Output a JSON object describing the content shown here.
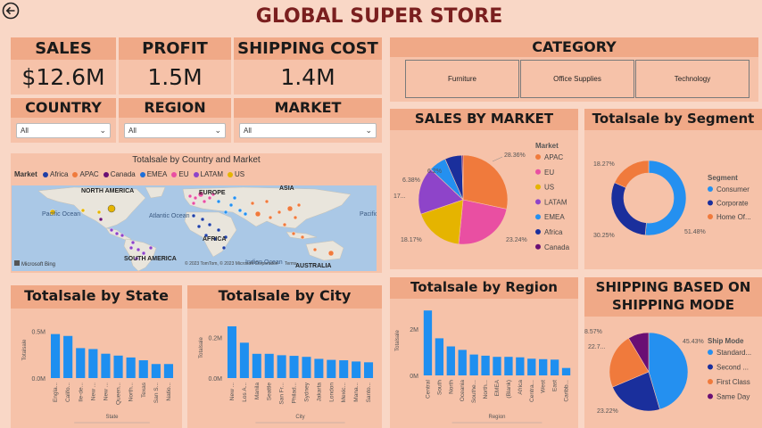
{
  "page_title": "GLOBAL SUPER STORE",
  "kpis": [
    {
      "label": "SALES",
      "value": "$12.6M"
    },
    {
      "label": "PROFIT",
      "value": "1.5M"
    },
    {
      "label": "SHIPPING COST",
      "value": "1.4M"
    }
  ],
  "filters": [
    {
      "label": "COUNTRY",
      "selected": "All"
    },
    {
      "label": "REGION",
      "selected": "All"
    },
    {
      "label": "MARKET",
      "selected": "All"
    }
  ],
  "category": {
    "title": "CATEGORY",
    "buttons": [
      "Furniture",
      "Office Supplies",
      "Technology"
    ]
  },
  "map": {
    "title": "Totalsale by Country and Market",
    "legend_title": "Market",
    "legend": [
      {
        "name": "Africa",
        "color": "#1f3fa6"
      },
      {
        "name": "APAC",
        "color": "#f07a3c"
      },
      {
        "name": "Canada",
        "color": "#6a0f74"
      },
      {
        "name": "EMEA",
        "color": "#1e6fd9"
      },
      {
        "name": "EU",
        "color": "#e94fa2"
      },
      {
        "name": "LATAM",
        "color": "#8e44c9"
      },
      {
        "name": "US",
        "color": "#e5b400"
      }
    ],
    "labels": [
      "NORTH AMERICA",
      "EUROPE",
      "ASIA",
      "Pacific Ocean",
      "Atlantic Ocean",
      "AFRICA",
      "Pacific Ocean",
      "SOUTH AMERICA",
      "Indian Ocean",
      "AUSTRALIA"
    ],
    "attribution": "© 2023 TomTom, © 2023 Microsoft Corporation",
    "attribution_terms": "Terms",
    "brand": "Microsoft Bing"
  },
  "sales_by_market": {
    "title": "SALES BY MARKET",
    "legend_title": "Market",
    "slice_labels": [
      "28.36%",
      "23.24%",
      "18.17%",
      "17...",
      "6.38%",
      "6.2%"
    ]
  },
  "segment": {
    "title": "Totalsale by Segment",
    "legend_title": "Segment",
    "legend": [
      {
        "name": "Consumer",
        "color": "#2490f0"
      },
      {
        "name": "Corporate",
        "color": "#1a2f9c"
      },
      {
        "name": "Home Of...",
        "color": "#f07a3c"
      }
    ],
    "slice_labels": [
      "51.48%",
      "30.25%",
      "18.27%"
    ]
  },
  "state_chart": {
    "title": "Totalsale by State",
    "ylabel": "Totalsale",
    "xlabel": "State",
    "ticks": [
      "0.5M",
      "0.0M"
    ]
  },
  "city_chart": {
    "title": "Totalsale by City",
    "ylabel": "Totalsale",
    "xlabel": "City",
    "ticks": [
      "0.2M",
      "0.0M"
    ]
  },
  "region_chart": {
    "title": "Totalsale by Region",
    "ylabel": "Totalsale",
    "xlabel": "Region",
    "ticks": [
      "2M",
      "0M"
    ]
  },
  "ship_mode": {
    "title_line1": "SHIPPING BASED ON",
    "title_line2": "SHIPPING MODE",
    "legend_title": "Ship Mode",
    "legend": [
      {
        "name": "Standard...",
        "color": "#2490f0"
      },
      {
        "name": "Second ...",
        "color": "#1a2f9c"
      },
      {
        "name": "First Class",
        "color": "#f07a3c"
      },
      {
        "name": "Same Day",
        "color": "#6a0f74"
      }
    ],
    "slice_labels": [
      "45.43%",
      "23.22%",
      "22.7...",
      "8.57%"
    ]
  },
  "chart_data": [
    {
      "type": "pie",
      "title": "SALES BY MARKET",
      "categories": [
        "APAC",
        "EU",
        "US",
        "LATAM",
        "EMEA",
        "Africa",
        "Canada"
      ],
      "values": [
        28.36,
        23.24,
        18.17,
        17.23,
        6.38,
        6.2,
        0.42
      ],
      "colors": [
        "#f07a3c",
        "#e94fa2",
        "#e5b400",
        "#8e44c9",
        "#2490f0",
        "#1a2f9c",
        "#6a0f74"
      ]
    },
    {
      "type": "pie",
      "title": "Totalsale by Segment",
      "categories": [
        "Consumer",
        "Corporate",
        "Home Of..."
      ],
      "values": [
        51.48,
        30.25,
        18.27
      ],
      "colors": [
        "#2490f0",
        "#1a2f9c",
        "#f07a3c"
      ]
    },
    {
      "type": "pie",
      "title": "SHIPPING BASED ON SHIPPING MODE",
      "categories": [
        "Standard...",
        "Second ...",
        "First Class",
        "Same Day"
      ],
      "values": [
        45.43,
        23.22,
        22.78,
        8.57
      ],
      "colors": [
        "#2490f0",
        "#1a2f9c",
        "#f07a3c",
        "#6a0f74"
      ]
    },
    {
      "type": "bar",
      "title": "Totalsale by State",
      "categories": [
        "Engla...",
        "Califo...",
        "Ile-de...",
        "New ...",
        "New ...",
        "Queen...",
        "North...",
        "Texas",
        "San S...",
        "Natio..."
      ],
      "values": [
        0.47,
        0.45,
        0.32,
        0.31,
        0.26,
        0.24,
        0.22,
        0.19,
        0.15,
        0.15
      ],
      "ylabel": "Totalsale",
      "xlabel": "State",
      "ylim": [
        0,
        0.6
      ]
    },
    {
      "type": "bar",
      "title": "Totalsale by City",
      "categories": [
        "New ...",
        "Los A...",
        "Manila",
        "Seattle",
        "San Fr...",
        "Philad...",
        "Sydney",
        "Jakarta",
        "London",
        "Mexic...",
        "Mana...",
        "Santo..."
      ],
      "values": [
        0.256,
        0.175,
        0.12,
        0.12,
        0.113,
        0.11,
        0.105,
        0.095,
        0.09,
        0.088,
        0.082,
        0.078
      ],
      "ylabel": "Totalsale",
      "xlabel": "City",
      "ylim": [
        0,
        0.3
      ]
    },
    {
      "type": "bar",
      "title": "Totalsale by Region",
      "categories": [
        "Central",
        "South",
        "North",
        "Oceania",
        "Southe...",
        "North...",
        "EMEA",
        "(Blank)",
        "Africa",
        "Centra...",
        "West",
        "East",
        "Caribb..."
      ],
      "values": [
        2.8,
        1.6,
        1.25,
        1.1,
        0.9,
        0.85,
        0.8,
        0.8,
        0.78,
        0.72,
        0.7,
        0.68,
        0.32
      ],
      "ylabel": "Totalsale",
      "xlabel": "Region",
      "ylim": [
        0,
        3
      ]
    }
  ]
}
